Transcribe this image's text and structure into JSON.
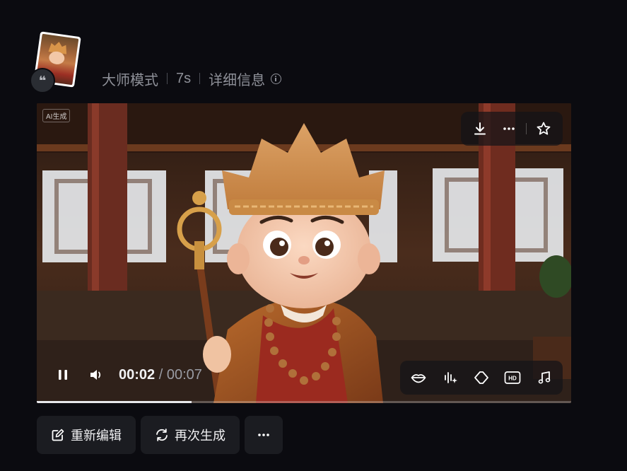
{
  "meta": {
    "mode": "大师模式",
    "duration": "7s",
    "details": "详细信息"
  },
  "video": {
    "ai_badge": "AI生成",
    "current_time": "00:02",
    "separator": "/",
    "total_time": "00:07",
    "progress_fraction": 0.29
  },
  "toolbar_top": {
    "icons": [
      "download-icon",
      "more-icon",
      "star-icon"
    ]
  },
  "toolbar_bottom": {
    "icons": [
      "lips-icon",
      "audio-sparkle-icon",
      "diamond-icon",
      "hd-icon",
      "music-note-icon"
    ],
    "hd_label": "HD"
  },
  "actions": {
    "re_edit": "重新编辑",
    "regenerate": "再次生成"
  },
  "avatar": {
    "quote_glyph": "❝"
  }
}
